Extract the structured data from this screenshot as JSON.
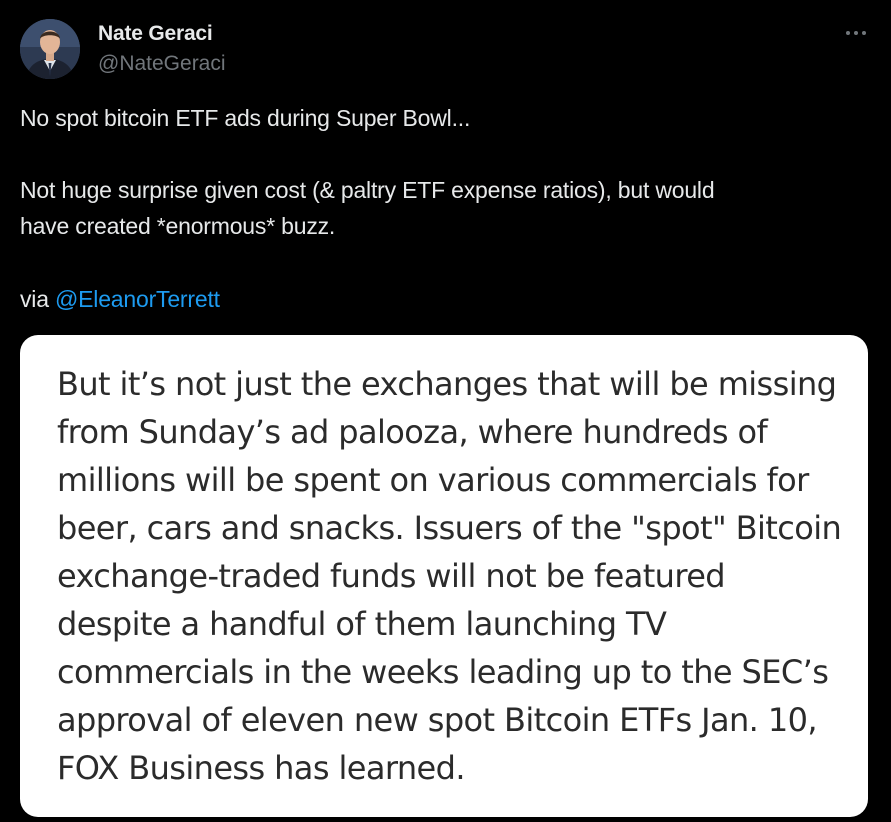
{
  "author": {
    "name": "Nate Geraci",
    "handle": "@NateGeraci"
  },
  "tweet": {
    "line1": "No spot bitcoin ETF ads during Super Bowl...",
    "line2": "Not huge surprise given cost (& paltry ETF expense ratios), but would",
    "line3": "have created *enormous* buzz.",
    "via_prefix": "via",
    "mention": "@EleanorTerrett"
  },
  "embedded_image": {
    "lines": [
      "But it’s not just the exchanges that will be missing",
      "from Sunday’s ad palooza, where hundreds of",
      "millions will be spent on various commercials for",
      "beer, cars and snacks. Issuers of the \"spot\" Bitcoin",
      "exchange-traded funds will not be featured",
      "despite a handful of them launching TV",
      "commercials in the weeks leading up to the SEC’s",
      "approval of eleven new spot Bitcoin ETFs Jan. 10,",
      "FOX Business has learned."
    ]
  },
  "icons": {
    "more": "more-options-icon",
    "avatar": "profile-photo"
  },
  "colors": {
    "background": "#000000",
    "text": "#e7e9ea",
    "secondary": "#71767b",
    "link": "#1d9bf0",
    "card_bg": "#ffffff",
    "card_text": "#2b2b2b"
  }
}
